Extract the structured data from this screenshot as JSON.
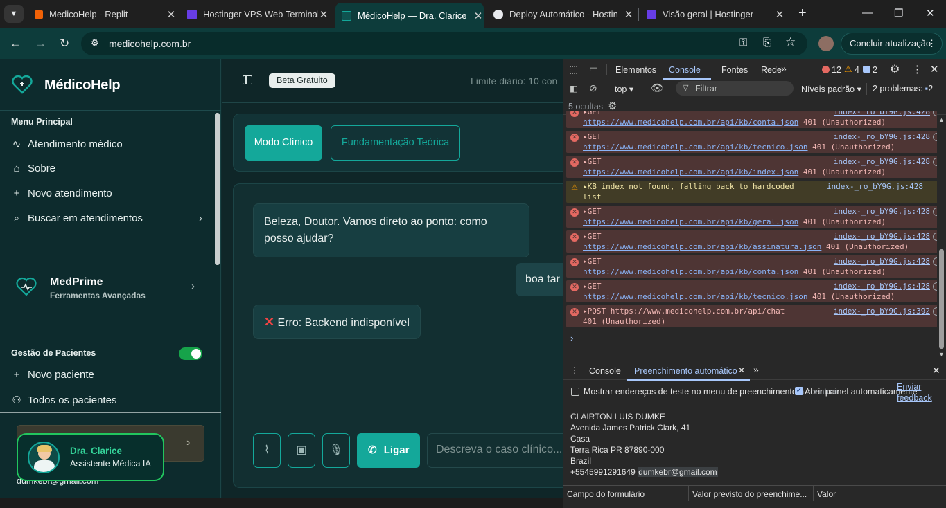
{
  "browser": {
    "tabs": [
      {
        "label": "MedicoHelp - Replit",
        "icon": "replit-icon",
        "color": "#f26207",
        "active": false
      },
      {
        "label": "Hostinger VPS Web Terminal",
        "icon": "hostinger-icon",
        "color": "#673de6",
        "active": false
      },
      {
        "label": "MédicoHelp — Dra. Clarice",
        "icon": "medicohelp-icon",
        "color": "#14a89a",
        "active": true
      },
      {
        "label": "Deploy Automático - Hostin",
        "icon": "github-icon",
        "color": "#ffffff",
        "active": false
      },
      {
        "label": "Visão geral | Hostinger",
        "icon": "hostinger-icon",
        "color": "#673de6",
        "active": false
      }
    ],
    "url": "medicohelp.com.br",
    "update_label": "Concluir atualização"
  },
  "app": {
    "brand": "MédicoHelp",
    "menu_title": "Menu Principal",
    "menu": [
      {
        "label": "Atendimento médico",
        "icon": "activity-icon"
      },
      {
        "label": "Sobre",
        "icon": "home-icon"
      },
      {
        "label": "Novo atendimento",
        "icon": "plus-icon"
      },
      {
        "label": "Buscar em atendimentos",
        "icon": "search-icon"
      }
    ],
    "medprime": {
      "title": "MedPrime",
      "subtitle": "Ferramentas Avançadas"
    },
    "patients_title": "Gestão de Pacientes",
    "patients_toggle": true,
    "patients_menu": [
      {
        "label": "Novo paciente",
        "icon": "plus-icon"
      },
      {
        "label": "Todos os pacientes",
        "icon": "users-icon"
      }
    ],
    "user_email": "dumkebr@gmail.com",
    "assistant": {
      "name": "Dra. Clarice",
      "role": "Assistente Médica IA"
    },
    "header": {
      "badge": "Beta Gratuito",
      "limit": "Limite diário: 10 con"
    },
    "modes": [
      "Modo Clínico",
      "Fundamentação Teórica"
    ],
    "messages": {
      "bot": "Beleza, Doutor. Vamos direto ao ponto: como posso ajudar?",
      "user": "boa tar",
      "error": "Erro: Backend indisponível"
    },
    "composer": {
      "call_label": "Ligar",
      "placeholder": "Descreva o caso clínico..."
    },
    "accent": "#14a89a"
  },
  "devtools": {
    "tabs": [
      "Elementos",
      "Console",
      "Fontes",
      "Rede"
    ],
    "active_tab": "Console",
    "errors": "12",
    "warnings": "4",
    "infos": "2",
    "context": "top",
    "filter_placeholder": "Filtrar",
    "levels": "Níveis padrão",
    "problems": "2 problemas:",
    "problems_count": "2",
    "hidden": "5 ocultas",
    "logs": [
      {
        "type": "error",
        "method": "▸GET",
        "url": "https://www.medicohelp.com.br/api/kb/conta.json",
        "status": "401 (Unauthorized)",
        "source": "index-_ro_bY9G.js:428"
      },
      {
        "type": "error",
        "method": "▸GET",
        "url": "https://www.medicohelp.com.br/api/kb/tecnico.json",
        "status": "401 (Unauthorized)",
        "source": "index-_ro_bY9G.js:428"
      },
      {
        "type": "error",
        "method": "▸GET",
        "url": "https://www.medicohelp.com.br/api/kb/index.json",
        "status": "401 (Unauthorized)",
        "source": "index-_ro_bY9G.js:428"
      },
      {
        "type": "warn",
        "method": "▸KB index not found, falling back to hardcoded",
        "url": "list",
        "status": "",
        "source": "index-_ro_bY9G.js:428"
      },
      {
        "type": "error",
        "method": "▸GET",
        "url": "https://www.medicohelp.com.br/api/kb/geral.json",
        "status": "401 (Unauthorized)",
        "source": "index-_ro_bY9G.js:428"
      },
      {
        "type": "error",
        "method": "▸GET",
        "url": "https://www.medicohelp.com.br/api/kb/assinatura.json",
        "status": "401 (Unauthorized)",
        "source": "index-_ro_bY9G.js:428"
      },
      {
        "type": "error",
        "method": "▸GET",
        "url": "https://www.medicohelp.com.br/api/kb/conta.json",
        "status": "401 (Unauthorized)",
        "source": "index-_ro_bY9G.js:428"
      },
      {
        "type": "error",
        "method": "▸GET",
        "url": "https://www.medicohelp.com.br/api/kb/tecnico.json",
        "status": "401 (Unauthorized)",
        "source": "index-_ro_bY9G.js:428"
      },
      {
        "type": "error",
        "method": "▸POST https://www.medicohelp.com.br/api/chat",
        "url": "",
        "status": "401 (Unauthorized)",
        "source": "index-_ro_bY9G.js:392"
      }
    ],
    "drawer": {
      "tabs": [
        "Console",
        "Preenchimento automático"
      ],
      "active": "Preenchimento automático",
      "show_test_label": "Mostrar endereços de teste no menu de preenchimento a",
      "open_panel_label": "Abrir painel automaticamente",
      "overlap_text": "ccentuar",
      "feedback": "Enviar feedback",
      "address": [
        "CLAIRTON LUIS DUMKE",
        "Avenida James Patrick Clark, 41",
        "Casa",
        "Terra Rica PR 87890-000",
        "Brazil"
      ],
      "phone": "+5545991291649",
      "email": "dumkebr@gmail.com",
      "columns": [
        "Campo do formulário",
        "Valor previsto do preenchime...",
        "Valor"
      ]
    }
  }
}
